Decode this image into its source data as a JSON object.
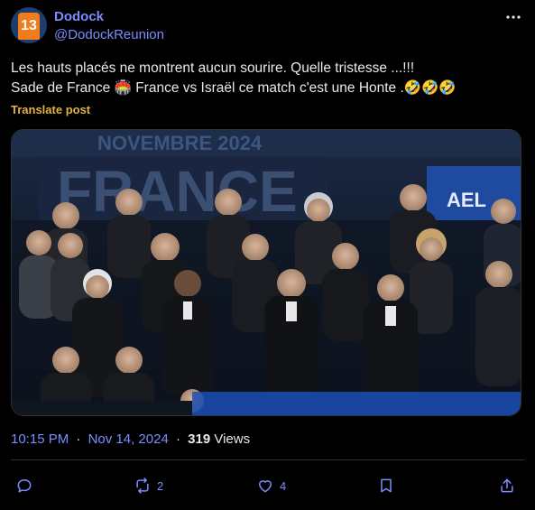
{
  "author": {
    "display_name": "Dodock",
    "handle": "@DodockReunion",
    "avatar_number": "13"
  },
  "post": {
    "line1": "Les hauts placés ne montrent aucun sourire. Quelle tristesse ...!!!",
    "line2": "Sade de France 🏟️ France vs Israël ce match c'est une Honte .🤣🤣🤣",
    "translate_label": "Translate post",
    "photo_banner_text": "FRANCE",
    "photo_banner_date": "NOVEMBRE 2024",
    "photo_banner_right": "AEL"
  },
  "meta": {
    "time": "10:15 PM",
    "date": "Nov 14, 2024",
    "separator1": "·",
    "separator2": "·",
    "views_count": "319",
    "views_label": "Views"
  },
  "actions": {
    "reply_count": "",
    "repost_count": "2",
    "like_count": "4"
  },
  "colors": {
    "accent": "#7b8cff",
    "translate": "#e3b341",
    "background": "#000000",
    "text": "#e7e9ea"
  }
}
